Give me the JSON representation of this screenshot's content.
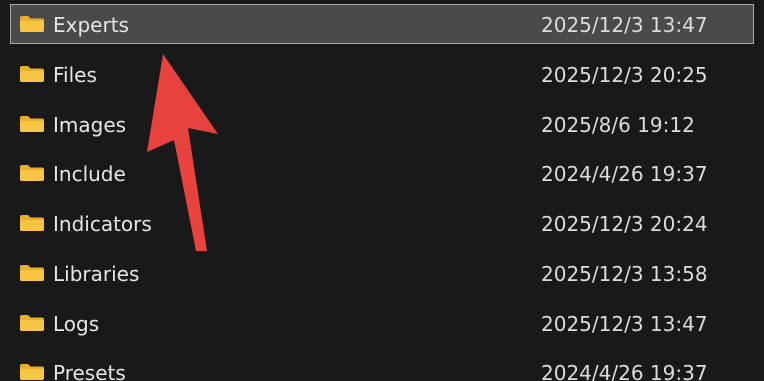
{
  "colors": {
    "background": "#191919",
    "selected_row": "#4a4a4a",
    "selected_border": "#a8a8a8",
    "folder": "#f6c543",
    "annotation_arrow": "#e8423f"
  },
  "icon": "folder-icon",
  "annotation": "red-arrow-pointing-to-experts",
  "selected_index": 0,
  "files": [
    {
      "name": "Experts",
      "modified": "2025/12/3 13:47"
    },
    {
      "name": "Files",
      "modified": "2025/12/3 20:25"
    },
    {
      "name": "Images",
      "modified": "2025/8/6 19:12"
    },
    {
      "name": "Include",
      "modified": "2024/4/26 19:37"
    },
    {
      "name": "Indicators",
      "modified": "2025/12/3 20:24"
    },
    {
      "name": "Libraries",
      "modified": "2025/12/3 13:58"
    },
    {
      "name": "Logs",
      "modified": "2025/12/3 13:47"
    },
    {
      "name": "Presets",
      "modified": "2024/4/26 19:37"
    }
  ]
}
